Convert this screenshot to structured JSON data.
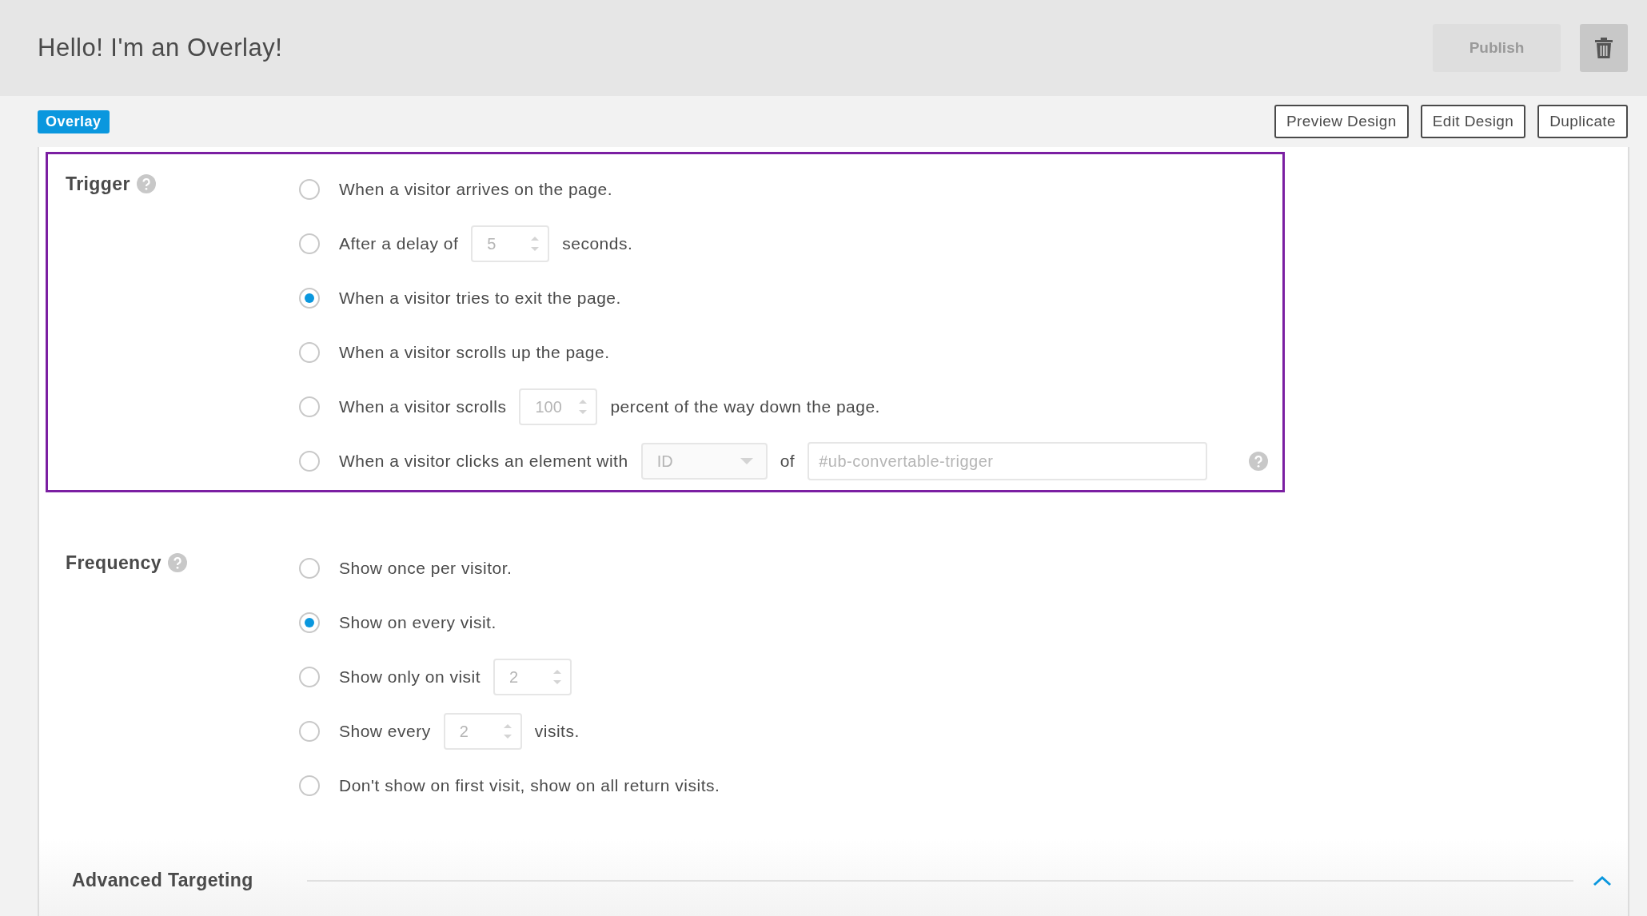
{
  "header": {
    "title": "Hello! I'm an Overlay!",
    "publish_button": {
      "label": "Publish",
      "disabled": true
    }
  },
  "toolbar": {
    "badge": "Overlay",
    "buttons": [
      "Preview Design",
      "Edit Design",
      "Duplicate"
    ]
  },
  "sections": [
    {
      "title": "Trigger",
      "highlighted": true,
      "options": [
        {
          "selected": false,
          "parts": [
            {
              "kind": "text",
              "text": "When a visitor arrives on the page."
            }
          ]
        },
        {
          "selected": false,
          "parts": [
            {
              "kind": "text",
              "text": "After a delay of"
            },
            {
              "kind": "spinner",
              "value": "5"
            },
            {
              "kind": "text",
              "text": "seconds."
            }
          ]
        },
        {
          "selected": true,
          "parts": [
            {
              "kind": "text",
              "text": "When a visitor tries to exit the page."
            }
          ]
        },
        {
          "selected": false,
          "parts": [
            {
              "kind": "text",
              "text": "When a visitor scrolls up the page."
            }
          ]
        },
        {
          "selected": false,
          "parts": [
            {
              "kind": "text",
              "text": "When a visitor scrolls"
            },
            {
              "kind": "spinner",
              "value": "100"
            },
            {
              "kind": "text",
              "text": "percent of the way down the page."
            }
          ]
        },
        {
          "selected": false,
          "parts": [
            {
              "kind": "text",
              "text": "When a visitor clicks an element with"
            },
            {
              "kind": "select",
              "value": "ID"
            },
            {
              "kind": "text",
              "text": "of"
            },
            {
              "kind": "input",
              "placeholder": "#ub-convertable-trigger"
            },
            {
              "kind": "help"
            }
          ]
        }
      ]
    },
    {
      "title": "Frequency",
      "highlighted": false,
      "options": [
        {
          "selected": false,
          "parts": [
            {
              "kind": "text",
              "text": "Show once per visitor."
            }
          ]
        },
        {
          "selected": true,
          "parts": [
            {
              "kind": "text",
              "text": "Show on every visit."
            }
          ]
        },
        {
          "selected": false,
          "parts": [
            {
              "kind": "text",
              "text": "Show only on visit"
            },
            {
              "kind": "spinner",
              "value": "2"
            }
          ]
        },
        {
          "selected": false,
          "parts": [
            {
              "kind": "text",
              "text": "Show every"
            },
            {
              "kind": "spinner",
              "value": "2"
            },
            {
              "kind": "text",
              "text": "visits."
            }
          ]
        },
        {
          "selected": false,
          "parts": [
            {
              "kind": "text",
              "text": "Don't show on first visit, show on all return visits."
            }
          ]
        }
      ]
    }
  ],
  "advanced": {
    "title": "Advanced Targeting",
    "expanded": true
  }
}
